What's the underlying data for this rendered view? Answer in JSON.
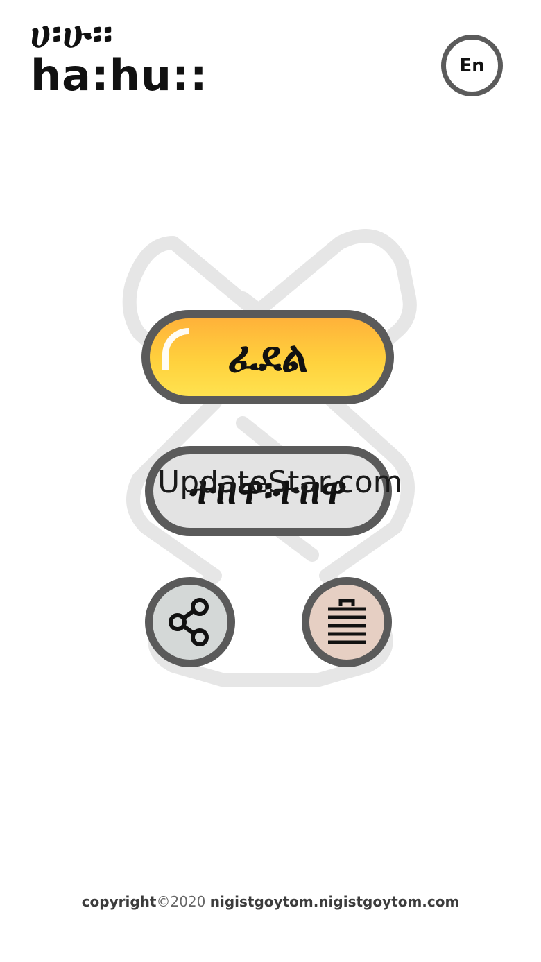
{
  "logo": {
    "line1": "ሀ፡ሁ፡፡",
    "line2": "ha:hu::"
  },
  "language_button": {
    "label": "En"
  },
  "buttons": {
    "play_label": "ፈደል",
    "learn_label": "ተዘዋ፡ተዘዋ"
  },
  "watermark": "UpdateStar.com",
  "icons": {
    "share": "share-icon",
    "list": "list-icon"
  },
  "footer": {
    "copyright_word": "copyright",
    "year": "©2020",
    "site": "nigistgoytom.nigistgoytom.com"
  },
  "colors": {
    "play_button_top": "#ffb23a",
    "play_button_bottom": "#ffe24f",
    "learn_button": "#e3e3e3",
    "share_button": "#d4d8d7",
    "list_button": "#e6cfc3",
    "border": "#5a5a5a"
  }
}
